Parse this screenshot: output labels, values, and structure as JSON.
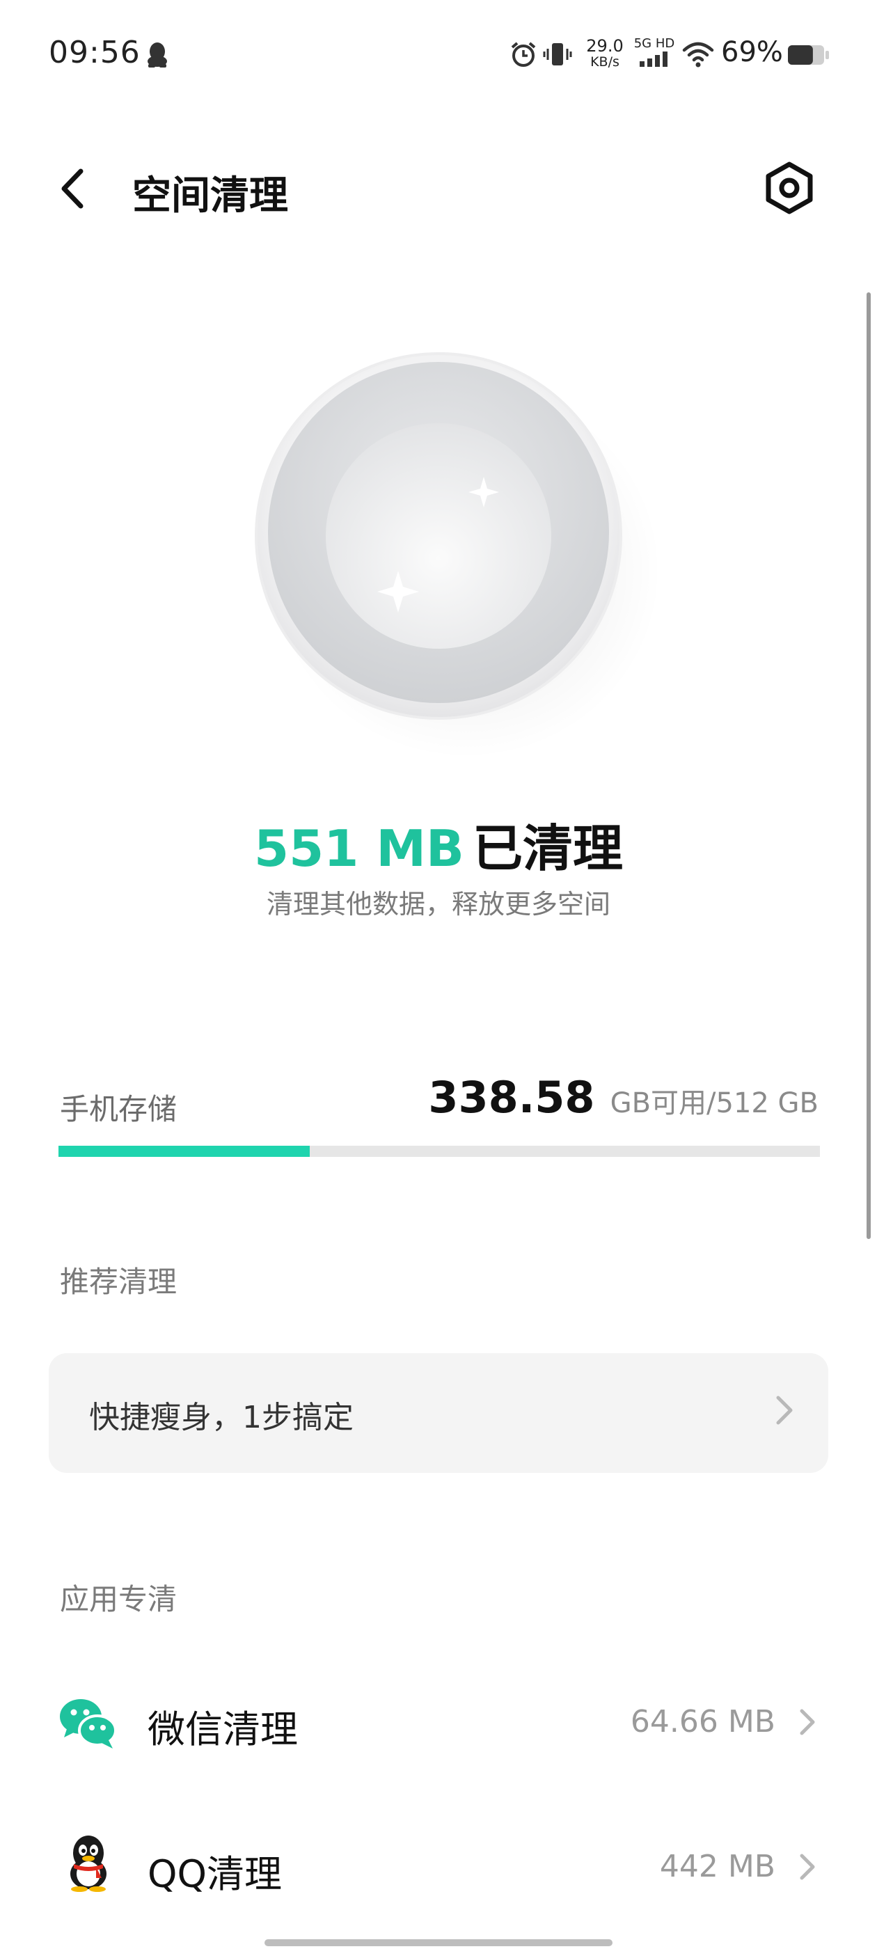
{
  "status_bar": {
    "time": "09:56",
    "net_speed_value": "29.0",
    "net_speed_unit": "KB/s",
    "network_label": "5G HD",
    "battery_percent": "69%",
    "battery_level": 0.69
  },
  "header": {
    "title": "空间清理"
  },
  "result": {
    "amount": "551 MB",
    "label": "已清理",
    "subtitle": "清理其他数据，释放更多空间"
  },
  "storage": {
    "label": "手机存储",
    "free": "338.58",
    "unit_text": "GB可用/512 GB",
    "used_fraction": 0.33
  },
  "recommended": {
    "section_title": "推荐清理",
    "card_text": "快捷瘦身，1步搞定"
  },
  "apps": {
    "section_title": "应用专清",
    "items": [
      {
        "name": "微信清理",
        "size": "64.66 MB",
        "icon": "wechat-icon"
      },
      {
        "name": "QQ清理",
        "size": "442 MB",
        "icon": "qq-icon"
      }
    ]
  },
  "colors": {
    "accent": "#1fc29d",
    "bar_fill": "#1fd4ae"
  }
}
